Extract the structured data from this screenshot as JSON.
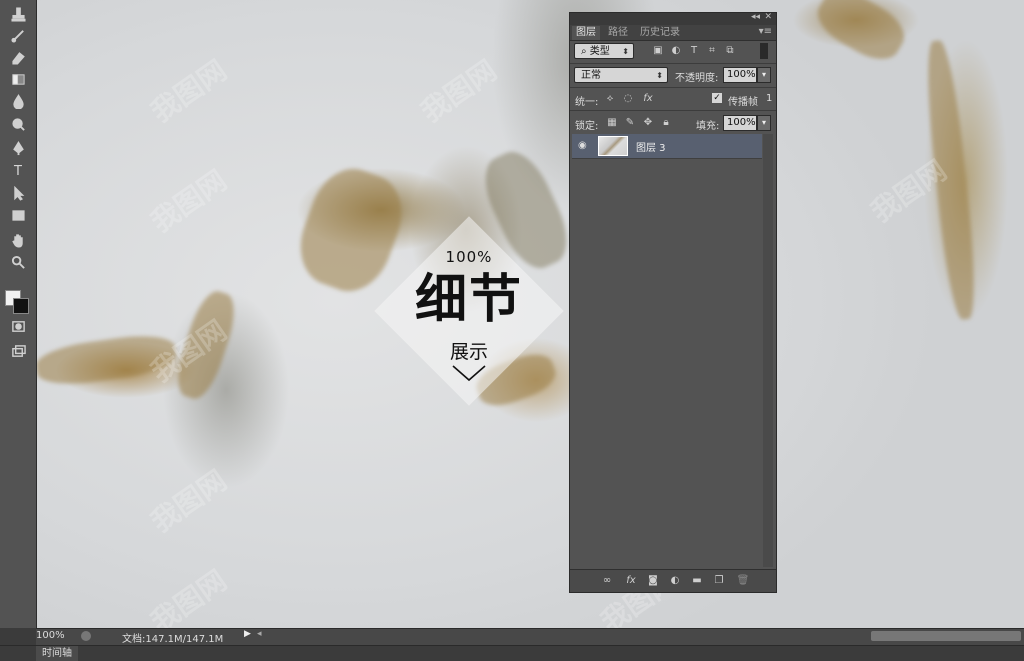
{
  "toolbar": {
    "tools": [
      "stamp-icon",
      "history-brush-icon",
      "eraser-icon",
      "gradient-icon",
      "blur-icon",
      "dodge-icon",
      "pen-icon",
      "type-icon",
      "path-selection-icon",
      "rectangle-icon",
      "hand-icon",
      "zoom-icon",
      "quick-mask-icon",
      "screen-mode-icon"
    ],
    "type_tool_glyph": "T",
    "foreground_color": "#f2f2f2",
    "background_color": "#111111"
  },
  "badge": {
    "percent": "100%",
    "title": "细节",
    "subtitle": "展示"
  },
  "panel": {
    "tabs": [
      "图层",
      "路径",
      "历史记录"
    ],
    "active_tab": "图层",
    "filter_select": "类型",
    "blend_mode": "正常",
    "opacity_label": "不透明度:",
    "opacity_value": "100%",
    "unify_label": "统一:",
    "propagate_label": "传播帧",
    "propagate_value": "1",
    "lock_label": "锁定:",
    "fill_label": "填充:",
    "fill_value": "100%",
    "layer_name": "图层 3"
  },
  "statusbar": {
    "zoom": "100%",
    "doc_size": "文档:147.1M/147.1M"
  },
  "bottom_tab": "时间轴",
  "watermark": "我图网"
}
